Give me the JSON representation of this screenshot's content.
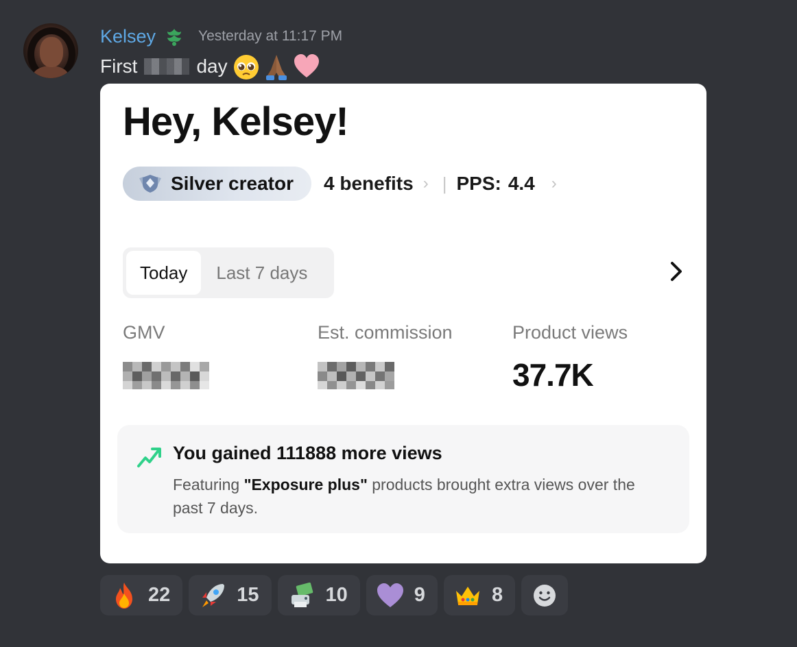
{
  "message": {
    "author": "Kelsey",
    "timestamp": "Yesterday at 11:17 PM",
    "text_before": "First",
    "text_after": "day",
    "emojis": [
      "pleading-face-emoji",
      "folded-hands-emoji",
      "pink-heart-emoji"
    ]
  },
  "card": {
    "greeting": "Hey, Kelsey!",
    "creator_badge": "Silver creator",
    "benefits": "4 benefits",
    "pps_label": "PPS:",
    "pps_value": "4.4",
    "tabs": [
      {
        "label": "Today",
        "active": true
      },
      {
        "label": "Last 7 days",
        "active": false
      }
    ],
    "metrics": [
      {
        "label": "GMV",
        "value": null
      },
      {
        "label": "Est. commission",
        "value": null
      },
      {
        "label": "Product views",
        "value": "37.7K"
      }
    ],
    "gain": {
      "title": "You gained 111888 more views",
      "body_prefix": "Featuring ",
      "body_bold": "\"Exposure plus\"",
      "body_suffix": " products brought extra views over the past 7 days."
    }
  },
  "reactions": [
    {
      "emoji": "fire-emoji",
      "count": "22"
    },
    {
      "emoji": "rocket-emoji",
      "count": "15"
    },
    {
      "emoji": "money-printer-emoji",
      "count": "10"
    },
    {
      "emoji": "purple-heart-emoji",
      "count": "9"
    },
    {
      "emoji": "crown-emoji",
      "count": "8"
    }
  ],
  "colors": {
    "background": "#313338",
    "username": "#5fa9e6",
    "card": "#ffffff",
    "trend_green": "#2fd18a"
  }
}
